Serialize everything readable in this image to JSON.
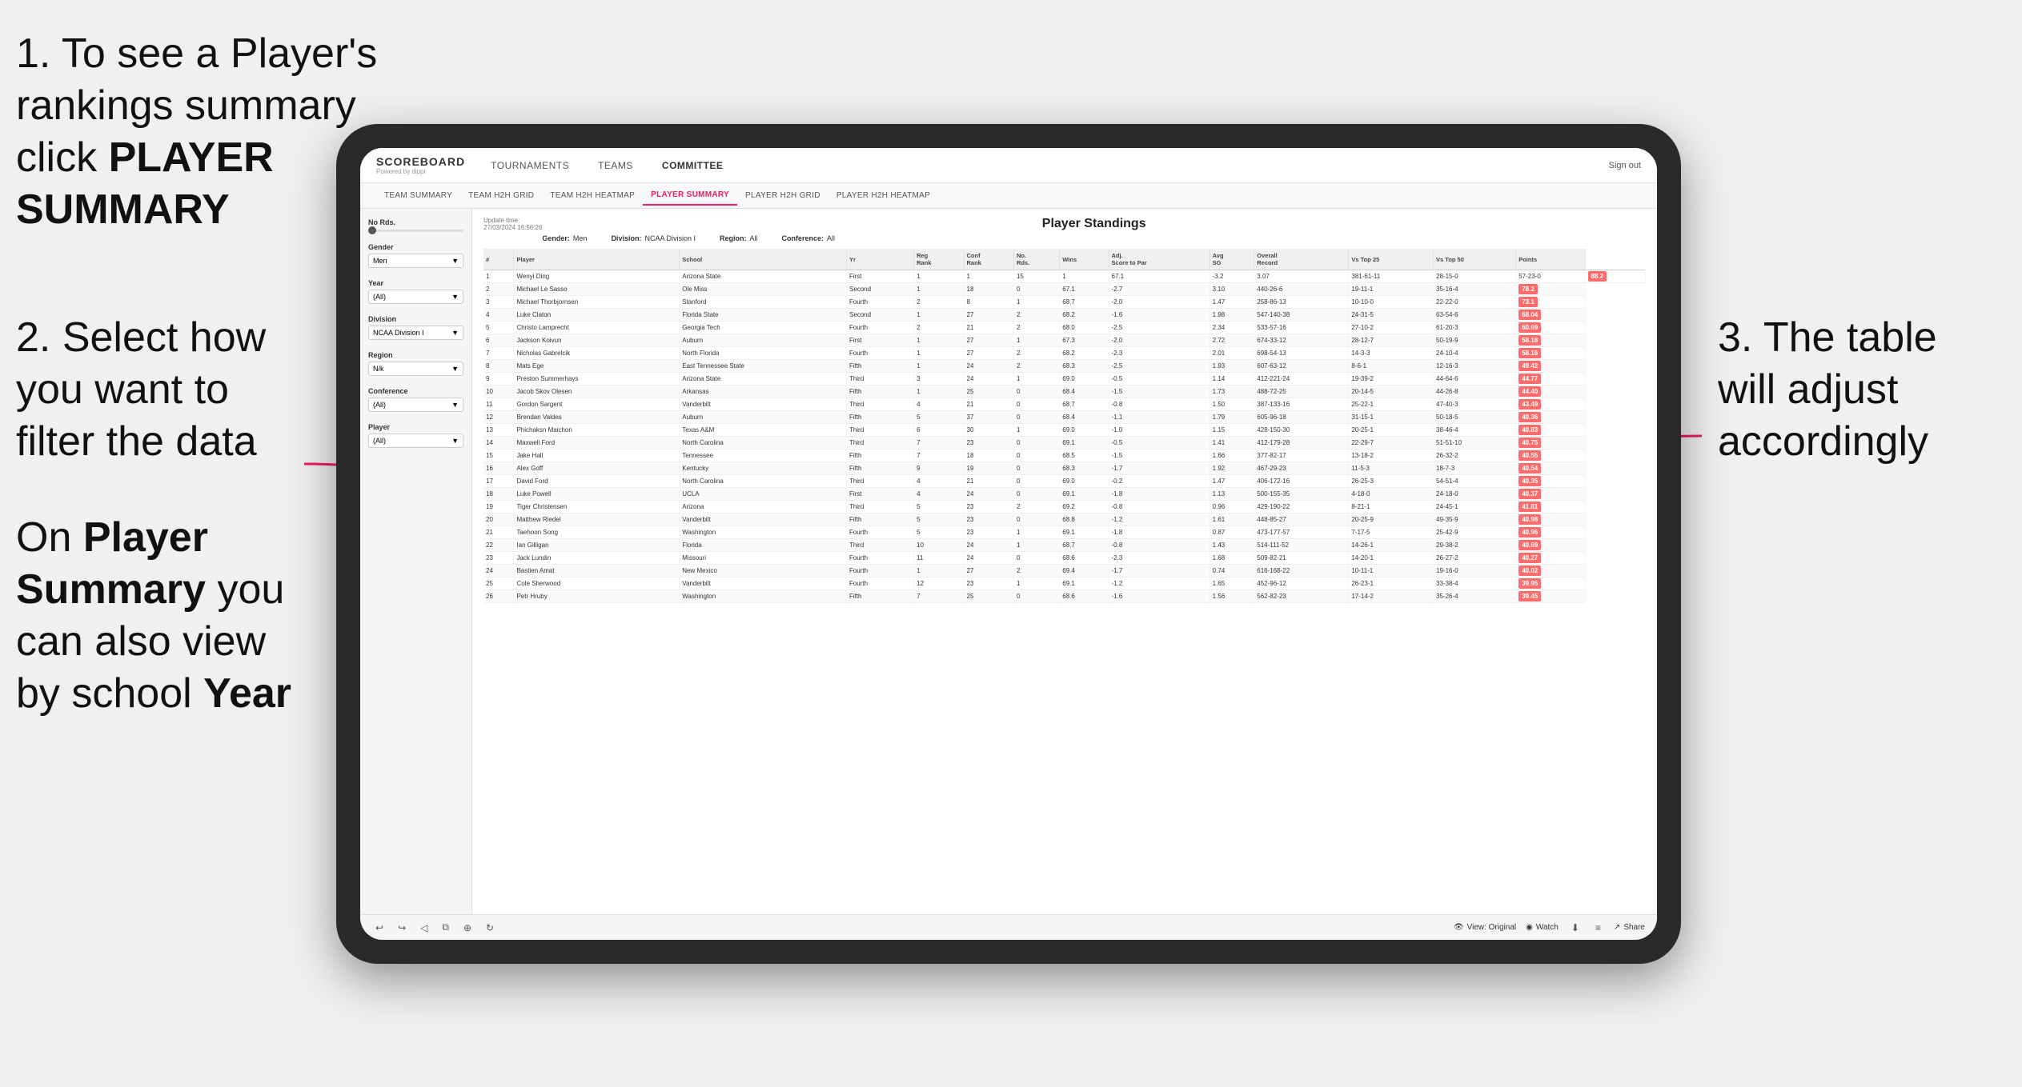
{
  "instructions": {
    "step1": "1. To see a Player's rankings summary click ",
    "step1_bold": "PLAYER SUMMARY",
    "step2_title": "2. Select how you want to filter the data",
    "step3": "3. The table will adjust accordingly",
    "bottom_note_prefix": "On ",
    "bottom_note_bold1": "Player Summary",
    "bottom_note_middle": " you can also view by school ",
    "bottom_note_bold2": "Year"
  },
  "app": {
    "logo": "SCOREBOARD",
    "logo_sub": "Powered by dippi",
    "sign_out": "Sign out"
  },
  "nav": {
    "items": [
      {
        "label": "TOURNAMENTS",
        "active": false
      },
      {
        "label": "TEAMS",
        "active": false
      },
      {
        "label": "COMMITTEE",
        "active": true
      }
    ]
  },
  "sub_nav": {
    "items": [
      {
        "label": "TEAM SUMMARY",
        "active": false
      },
      {
        "label": "TEAM H2H GRID",
        "active": false
      },
      {
        "label": "TEAM H2H HEATMAP",
        "active": false
      },
      {
        "label": "PLAYER SUMMARY",
        "active": true
      },
      {
        "label": "PLAYER H2H GRID",
        "active": false
      },
      {
        "label": "PLAYER H2H HEATMAP",
        "active": false
      }
    ]
  },
  "filters": {
    "no_rds_label": "No Rds.",
    "gender_label": "Gender",
    "gender_value": "Men",
    "year_label": "Year",
    "year_value": "(All)",
    "division_label": "Division",
    "division_value": "NCAA Division I",
    "region_label": "Region",
    "region_value": "N/k",
    "conference_label": "Conference",
    "conference_value": "(All)",
    "player_label": "Player",
    "player_value": "(All)"
  },
  "table": {
    "title": "Player Standings",
    "update_time": "Update time:",
    "update_date": "27/03/2024 16:56:26",
    "filter_row": {
      "gender_label": "Gender:",
      "gender_value": "Men",
      "division_label": "Division:",
      "division_value": "NCAA Division I",
      "region_label": "Region:",
      "region_value": "All",
      "conference_label": "Conference:",
      "conference_value": "All"
    },
    "columns": [
      "#",
      "Player",
      "School",
      "Yr",
      "Reg Rank",
      "Conf Rank",
      "No. Rds.",
      "Wins",
      "Adj. Score to Par",
      "Avg SG",
      "Overall Record",
      "Vs Top 25",
      "Vs Top 50",
      "Points"
    ],
    "rows": [
      [
        "1",
        "Wenyi Ding",
        "Arizona State",
        "First",
        "1",
        "1",
        "15",
        "1",
        "67.1",
        "-3.2",
        "3.07",
        "381-61-11",
        "28-15-0",
        "57-23-0",
        "88.2"
      ],
      [
        "2",
        "Michael Le Sasso",
        "Ole Miss",
        "Second",
        "1",
        "18",
        "0",
        "67.1",
        "-2.7",
        "3.10",
        "440-26-6",
        "19-11-1",
        "35-16-4",
        "78.2"
      ],
      [
        "3",
        "Michael Thorbjornsen",
        "Stanford",
        "Fourth",
        "2",
        "8",
        "1",
        "68.7",
        "-2.0",
        "1.47",
        "258-86-13",
        "10-10-0",
        "22-22-0",
        "73.1"
      ],
      [
        "4",
        "Luke Claton",
        "Florida State",
        "Second",
        "1",
        "27",
        "2",
        "68.2",
        "-1.6",
        "1.98",
        "547-140-38",
        "24-31-5",
        "63-54-6",
        "68.04"
      ],
      [
        "5",
        "Christo Lamprecht",
        "Georgia Tech",
        "Fourth",
        "2",
        "21",
        "2",
        "68.0",
        "-2.5",
        "2.34",
        "533-57-16",
        "27-10-2",
        "61-20-3",
        "60.69"
      ],
      [
        "6",
        "Jackson Koivun",
        "Auburn",
        "First",
        "1",
        "27",
        "1",
        "67.3",
        "-2.0",
        "2.72",
        "674-33-12",
        "28-12-7",
        "50-19-9",
        "58.18"
      ],
      [
        "7",
        "Nicholas Gabrelcik",
        "North Florida",
        "Fourth",
        "1",
        "27",
        "2",
        "68.2",
        "-2.3",
        "2.01",
        "698-54-13",
        "14-3-3",
        "24-10-4",
        "58.16"
      ],
      [
        "8",
        "Mats Ege",
        "East Tennessee State",
        "Fifth",
        "1",
        "24",
        "2",
        "68.3",
        "-2.5",
        "1.93",
        "607-63-12",
        "8-6-1",
        "12-16-3",
        "49.42"
      ],
      [
        "9",
        "Preston Summerhays",
        "Arizona State",
        "Third",
        "3",
        "24",
        "1",
        "69.0",
        "-0.5",
        "1.14",
        "412-221-24",
        "19-39-2",
        "44-64-6",
        "44.77"
      ],
      [
        "10",
        "Jacob Skov Olesen",
        "Arkansas",
        "Fifth",
        "1",
        "25",
        "0",
        "68.4",
        "-1.5",
        "1.73",
        "488-72-25",
        "20-14-5",
        "44-26-8",
        "44.40"
      ],
      [
        "11",
        "Gordon Sargent",
        "Vanderbilt",
        "Third",
        "4",
        "21",
        "0",
        "68.7",
        "-0.8",
        "1.50",
        "387-133-16",
        "25-22-1",
        "47-40-3",
        "43.49"
      ],
      [
        "12",
        "Brendan Valdes",
        "Auburn",
        "Fifth",
        "5",
        "37",
        "0",
        "68.4",
        "-1.1",
        "1.79",
        "605-96-18",
        "31-15-1",
        "50-18-5",
        "40.36"
      ],
      [
        "13",
        "Phichaksn Maichon",
        "Texas A&M",
        "Third",
        "6",
        "30",
        "1",
        "69.0",
        "-1.0",
        "1.15",
        "428-150-30",
        "20-25-1",
        "38-46-4",
        "40.83"
      ],
      [
        "14",
        "Maxwell Ford",
        "North Carolina",
        "Third",
        "7",
        "23",
        "0",
        "69.1",
        "-0.5",
        "1.41",
        "412-179-28",
        "22-29-7",
        "51-51-10",
        "40.75"
      ],
      [
        "15",
        "Jake Hall",
        "Tennessee",
        "Fifth",
        "7",
        "18",
        "0",
        "68.5",
        "-1.5",
        "1.66",
        "377-82-17",
        "13-18-2",
        "26-32-2",
        "40.55"
      ],
      [
        "16",
        "Alex Goff",
        "Kentucky",
        "Fifth",
        "9",
        "19",
        "0",
        "68.3",
        "-1.7",
        "1.92",
        "467-29-23",
        "11-5-3",
        "18-7-3",
        "40.54"
      ],
      [
        "17",
        "David Ford",
        "North Carolina",
        "Third",
        "4",
        "21",
        "0",
        "69.0",
        "-0.2",
        "1.47",
        "406-172-16",
        "26-25-3",
        "54-51-4",
        "40.35"
      ],
      [
        "18",
        "Luke Powell",
        "UCLA",
        "First",
        "4",
        "24",
        "0",
        "69.1",
        "-1.8",
        "1.13",
        "500-155-35",
        "4-18-0",
        "24-18-0",
        "40.37"
      ],
      [
        "19",
        "Tiger Christensen",
        "Arizona",
        "Third",
        "5",
        "23",
        "2",
        "69.2",
        "-0.8",
        "0.96",
        "429-190-22",
        "8-21-1",
        "24-45-1",
        "41.81"
      ],
      [
        "20",
        "Matthew Riedel",
        "Vanderbilt",
        "Fifth",
        "5",
        "23",
        "0",
        "68.8",
        "-1.2",
        "1.61",
        "448-85-27",
        "20-25-9",
        "49-35-9",
        "40.98"
      ],
      [
        "21",
        "Taehoon Song",
        "Washington",
        "Fourth",
        "5",
        "23",
        "1",
        "69.1",
        "-1.8",
        "0.87",
        "473-177-57",
        "7-17-5",
        "25-42-9",
        "40.96"
      ],
      [
        "22",
        "Ian Gilligan",
        "Florida",
        "Third",
        "10",
        "24",
        "1",
        "68.7",
        "-0.8",
        "1.43",
        "514-111-52",
        "14-26-1",
        "29-38-2",
        "40.69"
      ],
      [
        "23",
        "Jack Lundin",
        "Missouri",
        "Fourth",
        "11",
        "24",
        "0",
        "68.6",
        "-2.3",
        "1.68",
        "509-82-21",
        "14-20-1",
        "26-27-2",
        "40.27"
      ],
      [
        "24",
        "Bastien Amat",
        "New Mexico",
        "Fourth",
        "1",
        "27",
        "2",
        "69.4",
        "-1.7",
        "0.74",
        "616-168-22",
        "10-11-1",
        "19-16-0",
        "40.02"
      ],
      [
        "25",
        "Cole Sherwood",
        "Vanderbilt",
        "Fourth",
        "12",
        "23",
        "1",
        "69.1",
        "-1.2",
        "1.65",
        "452-96-12",
        "26-23-1",
        "33-38-4",
        "39.95"
      ],
      [
        "26",
        "Petr Hruby",
        "Washington",
        "Fifth",
        "7",
        "25",
        "0",
        "68.6",
        "-1.6",
        "1.56",
        "562-82-23",
        "17-14-2",
        "35-26-4",
        "39.45"
      ]
    ]
  },
  "toolbar": {
    "view_label": "View: Original",
    "watch_label": "Watch",
    "share_label": "Share"
  }
}
